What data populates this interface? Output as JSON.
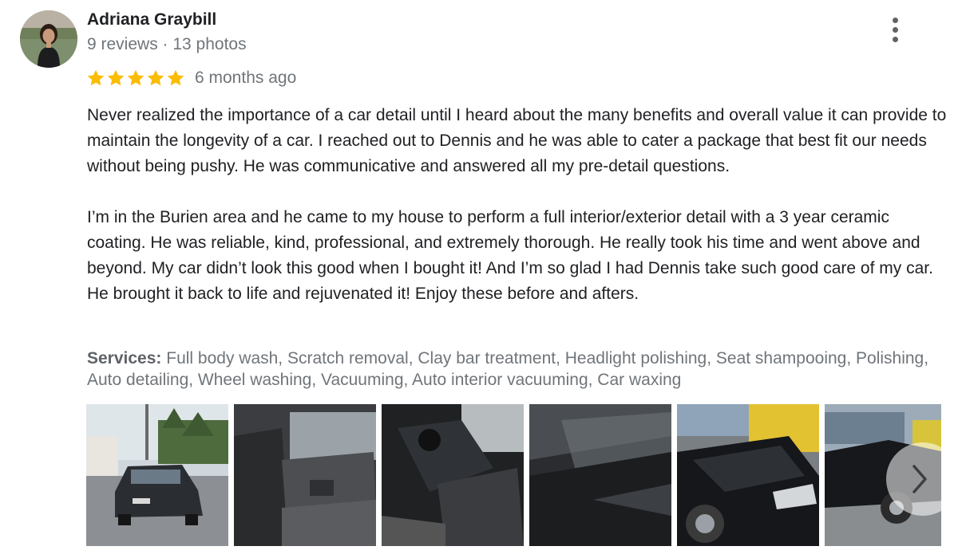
{
  "review": {
    "author": {
      "name": "Adriana Graybill",
      "stats": "9 reviews · 13 photos"
    },
    "rating": 5,
    "rating_max": 5,
    "time_ago": "6 months ago",
    "paragraphs": [
      "Never realized the importance of a car detail until I heard about the many benefits and overall value it can provide to maintain the longevity of a car. I reached out to Dennis and he was able to cater a package that best fit our needs without being pushy. He was communicative and answered all my pre-detail questions.",
      "I’m in the Burien area and he came to my house to perform a full interior/exterior detail with a 3 year ceramic coating. He was reliable, kind, professional, and extremely thorough. He really took his time and went above and beyond. My car didn’t look this good when I bought it! And I’m so glad I had Dennis take such good care of my car. He brought it back to life and rejuvenated it! Enjoy these before and afters."
    ],
    "services": {
      "label": "Services:",
      "text": " Full body wash, Scratch removal, Clay bar treatment, Headlight polishing, Seat shampooing, Polishing, Auto detailing, Wheel washing, Vacuuming, Auto interior vacuuming, Car waxing"
    },
    "photos_count_visible": 6
  },
  "colors": {
    "star": "#fbbc04",
    "text_primary": "#202124",
    "text_secondary": "#70757a",
    "icon": "#5f6368"
  },
  "icons": {
    "more": "more-vert-icon",
    "next": "chevron-right-icon",
    "star": "star-icon"
  }
}
